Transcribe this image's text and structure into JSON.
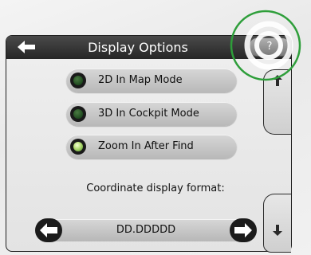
{
  "header": {
    "title": "Display Options",
    "help_label": "?",
    "back_icon": "back-arrow-icon"
  },
  "options": [
    {
      "label": "2D In Map Mode",
      "selected": false
    },
    {
      "label": "3D In Cockpit Mode",
      "selected": false
    },
    {
      "label": "Zoom In  After Find",
      "selected": true
    }
  ],
  "format": {
    "label": "Coordinate display format:",
    "value": "DD.DDDDD",
    "prev_icon": "arrow-left-icon",
    "next_icon": "arrow-right-icon"
  },
  "scroll": {
    "up_icon": "arrow-up-icon",
    "down_icon": "arrow-down-icon"
  },
  "colors": {
    "titlebar": "#2f2f2f",
    "highlight_ring": "#2e9e3a",
    "radio_selected": "#b9e07a"
  }
}
